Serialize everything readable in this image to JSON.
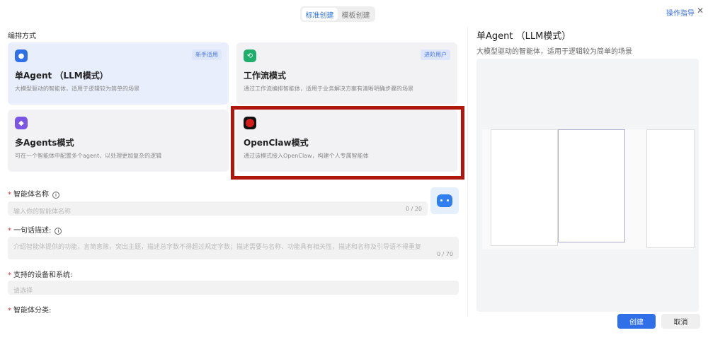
{
  "tabs": [
    {
      "label": "标准创建",
      "active": true
    },
    {
      "label": "模板创建",
      "active": false
    }
  ],
  "header": {
    "guide_label": "操作指导",
    "close_icon": "close-icon"
  },
  "section_title": "编排方式",
  "modes": [
    {
      "title": "单Agent （LLM模式）",
      "desc": "大模型驱动的智能体，适用于逻辑较为简单的场景",
      "badge": "新手适用",
      "icon": "robot-icon",
      "color": "#2f6fe8",
      "selected": true
    },
    {
      "title": "工作流模式",
      "desc": "通过工作流编排智能体，适用于业务解决方案有清晰明确步骤的场景",
      "badge": "进阶用户",
      "icon": "workflow-icon",
      "color": "#1fae6b"
    },
    {
      "title": "多Agents模式",
      "desc": "可在一个智能体中配置多个agent，以处理更加复杂的逻辑",
      "icon": "cube-icon",
      "color": "#7b55e6"
    },
    {
      "title": "OpenClaw模式",
      "desc": "通过该模式接入OpenClaw，构建个人专属智能体",
      "icon": "openclaw-icon",
      "color": "#d41b1b",
      "highlighted": true
    }
  ],
  "form": {
    "name_label": "智能体名称",
    "name_placeholder": "输入你的智能体名称",
    "name_count": "0 / 20",
    "desc_label": "一句话描述:",
    "desc_placeholder": "介绍智能体提供的功能，言简意赅，突出主题，描述总字数不得超过规定字数；描述需要与名称、功能具有相关性，描述和名称及引导语不得重复",
    "desc_count": "0 / 70",
    "device_label": "支持的设备和系统:",
    "device_placeholder": "请选择",
    "category_label": "智能体分类:"
  },
  "preview": {
    "title": "单Agent （LLM模式）",
    "desc": "大模型驱动的智能体，适用于逻辑较为简单的场景"
  },
  "footer": {
    "create_label": "创建",
    "cancel_label": "取消"
  },
  "colors": {
    "accent": "#2f6fe0",
    "highlight_box": "#b0170c"
  }
}
